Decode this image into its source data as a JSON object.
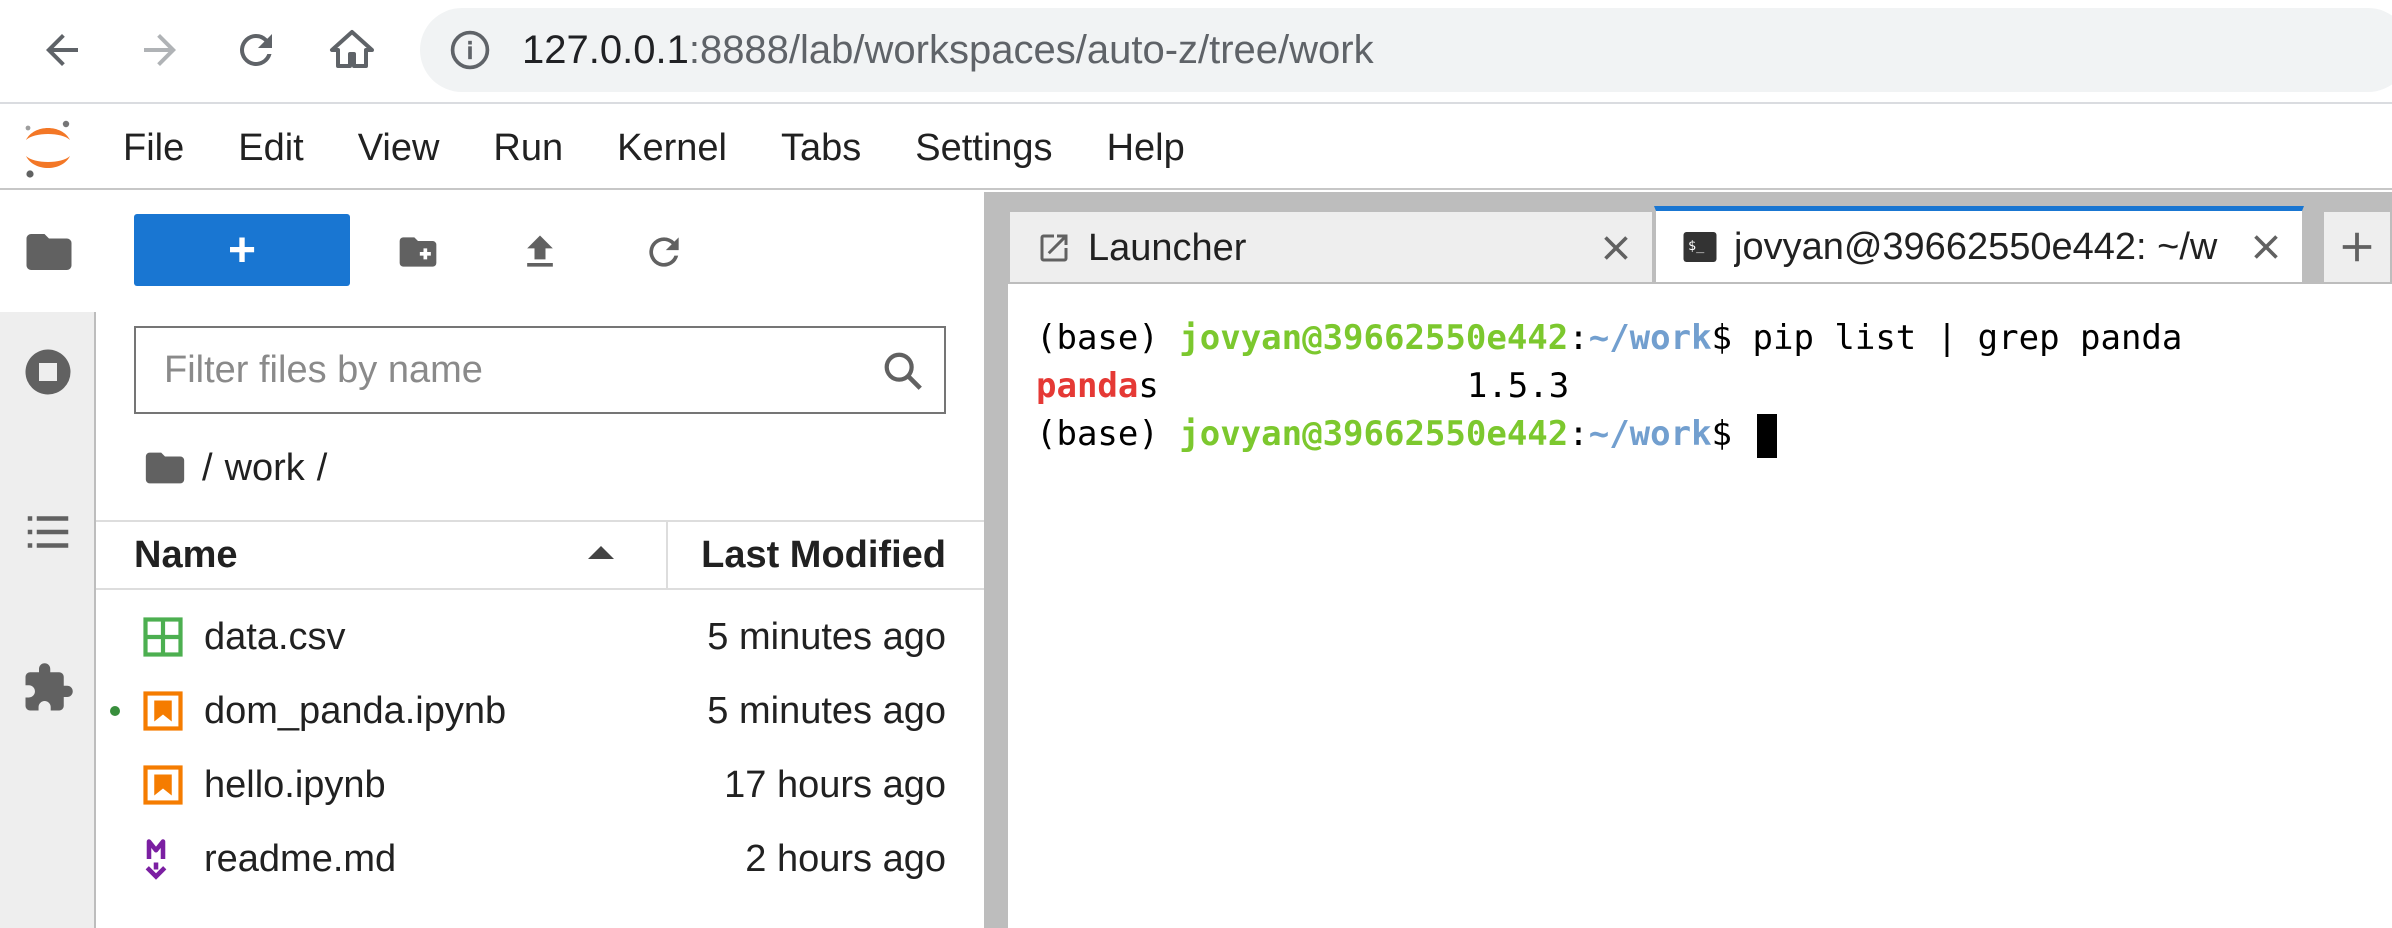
{
  "browser": {
    "url_host": "127.0.0.1",
    "url_rest": ":8888/lab/workspaces/auto-z/tree/work"
  },
  "menubar": {
    "items": [
      "File",
      "Edit",
      "View",
      "Run",
      "Kernel",
      "Tabs",
      "Settings",
      "Help"
    ]
  },
  "file_browser": {
    "new_button_label": "+",
    "filter_placeholder": "Filter files by name",
    "breadcrumb": [
      "/",
      "work",
      "/"
    ],
    "columns": {
      "name": "Name",
      "modified": "Last Modified"
    },
    "files": [
      {
        "name": "data.csv",
        "modified": "5 minutes ago",
        "icon": "spreadsheet-icon",
        "running": false
      },
      {
        "name": "dom_panda.ipynb",
        "modified": "5 minutes ago",
        "icon": "notebook-icon",
        "running": true
      },
      {
        "name": "hello.ipynb",
        "modified": "17 hours ago",
        "icon": "notebook-icon",
        "running": false
      },
      {
        "name": "readme.md",
        "modified": "2 hours ago",
        "icon": "markdown-icon",
        "running": false
      }
    ]
  },
  "tabs": [
    {
      "label": "Launcher",
      "icon": "launcher-icon",
      "current": false
    },
    {
      "label": "jovyan@39662550e442: ~/w",
      "icon": "terminal-icon",
      "current": true
    }
  ],
  "terminal": {
    "prompt_env": "(base) ",
    "prompt_user": "jovyan@39662550e442",
    "prompt_sep": ":",
    "prompt_path": "~/work",
    "prompt_end": "$ ",
    "command": "pip list | grep panda",
    "output_match": "panda",
    "output_rest": "s",
    "output_version": "1.5.3"
  },
  "colors": {
    "accent": "#1976d2",
    "terminal_user": "#7cc82e",
    "terminal_path": "#729fcf",
    "grep_match": "#e53935",
    "notebook_orange": "#f57c00",
    "csv_green": "#4caf50",
    "markdown_purple": "#7b1fa2"
  }
}
